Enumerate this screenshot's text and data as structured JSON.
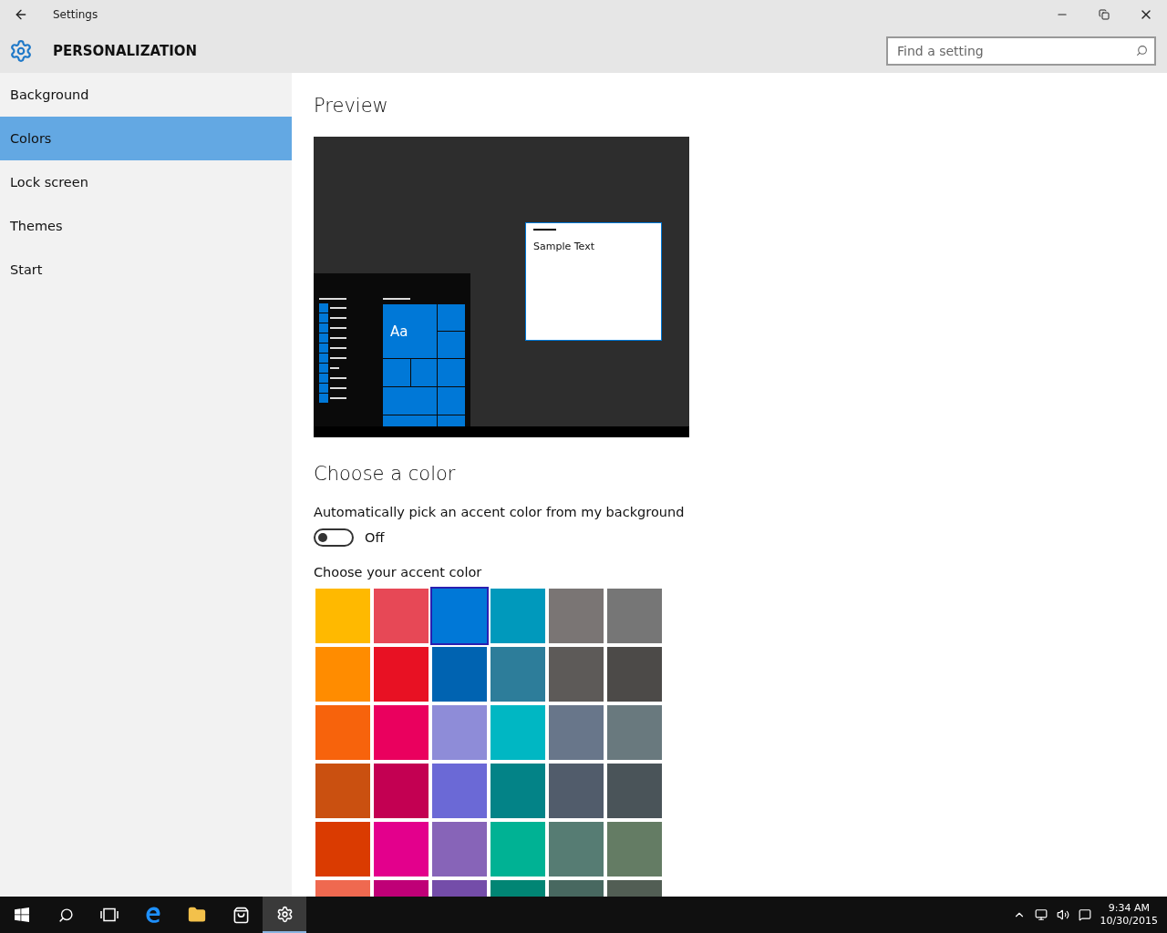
{
  "window": {
    "title": "Settings"
  },
  "header": {
    "title": "PERSONALIZATION",
    "search": {
      "placeholder": "Find a setting"
    }
  },
  "sidebar": {
    "items": [
      {
        "label": "Background",
        "selected": false
      },
      {
        "label": "Colors",
        "selected": true
      },
      {
        "label": "Lock screen",
        "selected": false
      },
      {
        "label": "Themes",
        "selected": false
      },
      {
        "label": "Start",
        "selected": false
      }
    ]
  },
  "preview": {
    "title": "Preview",
    "tile_label": "Aa",
    "window_text": "Sample Text"
  },
  "choose_color": {
    "title": "Choose a color",
    "auto_pick": {
      "label": "Automatically pick an accent color from my background",
      "on": false,
      "state_text": "Off"
    },
    "accent_label": "Choose your accent color",
    "swatches": [
      {
        "color": "#ffb900",
        "selected": false
      },
      {
        "color": "#e74856",
        "selected": false
      },
      {
        "color": "#0078d7",
        "selected": true
      },
      {
        "color": "#0099bc",
        "selected": false
      },
      {
        "color": "#7a7574",
        "selected": false
      },
      {
        "color": "#767676",
        "selected": false
      },
      {
        "color": "#ff8c00",
        "selected": false
      },
      {
        "color": "#e81123",
        "selected": false
      },
      {
        "color": "#0063b1",
        "selected": false
      },
      {
        "color": "#2d7d9a",
        "selected": false
      },
      {
        "color": "#5d5a58",
        "selected": false
      },
      {
        "color": "#4c4a48",
        "selected": false
      },
      {
        "color": "#f7630c",
        "selected": false
      },
      {
        "color": "#ea005e",
        "selected": false
      },
      {
        "color": "#8e8cd8",
        "selected": false
      },
      {
        "color": "#00b7c3",
        "selected": false
      },
      {
        "color": "#68768a",
        "selected": false
      },
      {
        "color": "#69797e",
        "selected": false
      },
      {
        "color": "#ca5010",
        "selected": false
      },
      {
        "color": "#c30052",
        "selected": false
      },
      {
        "color": "#6b69d6",
        "selected": false
      },
      {
        "color": "#038387",
        "selected": false
      },
      {
        "color": "#515c6b",
        "selected": false
      },
      {
        "color": "#4a5459",
        "selected": false
      },
      {
        "color": "#da3b01",
        "selected": false
      },
      {
        "color": "#e3008c",
        "selected": false
      },
      {
        "color": "#8764b8",
        "selected": false
      },
      {
        "color": "#00b294",
        "selected": false
      },
      {
        "color": "#567c73",
        "selected": false
      },
      {
        "color": "#647c64",
        "selected": false
      },
      {
        "color": "#ef6950",
        "selected": false
      },
      {
        "color": "#bf0077",
        "selected": false
      },
      {
        "color": "#744da9",
        "selected": false
      },
      {
        "color": "#018574",
        "selected": false
      },
      {
        "color": "#486860",
        "selected": false
      },
      {
        "color": "#525e54",
        "selected": false
      }
    ]
  },
  "taskbar": {
    "time": "9:34 AM",
    "date": "10/30/2015"
  }
}
